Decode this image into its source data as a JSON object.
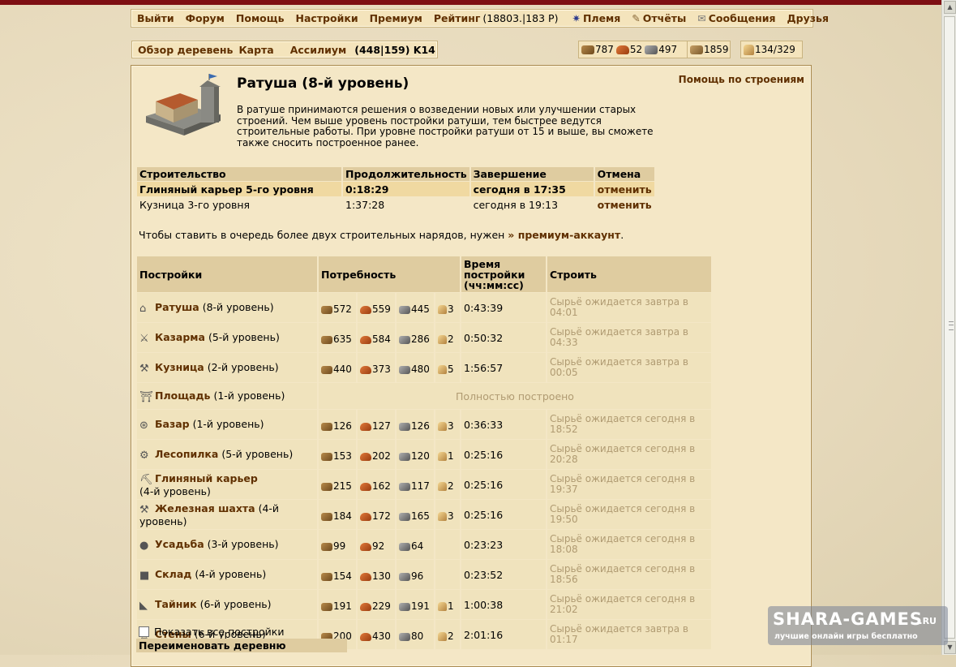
{
  "menu": {
    "logout": "Выйти",
    "forum": "Форум",
    "help": "Помощь",
    "settings": "Настройки",
    "premium": "Премиум",
    "ranking": "Рейтинг",
    "ranking_value": "(18803.|183 Р)",
    "tribe": "Племя",
    "reports": "Отчёты",
    "messages": "Сообщения",
    "friends": "Друзья"
  },
  "village": {
    "overview": "Обзор деревень",
    "map": "Карта",
    "name": "Ассилиум",
    "coords": "(448|159) K14"
  },
  "resources": {
    "wood": "787",
    "clay": "52",
    "iron": "497",
    "storage": "1859",
    "population": "134/329"
  },
  "building": {
    "title": "Ратуша (8-й уровень)",
    "help_link": "Помощь по строениям",
    "description": "В ратуше принимаются решения о возведении новых или улучшении старых строений. Чем выше уровень постройки ратуши, тем быстрее ведутся строительные работы. При уровне постройки ратуши от 15 и выше, вы сможете также сносить построенное ранее."
  },
  "queue": {
    "headers": [
      "Строительство",
      "Продолжительность",
      "Завершение",
      "Отмена"
    ],
    "rows": [
      {
        "name": "Глиняный карьер 5-го уровня",
        "duration": "0:18:29",
        "end": "сегодня в 17:35",
        "cancel": "отменить"
      },
      {
        "name": "Кузница 3-го уровня",
        "duration": "1:37:28",
        "end": "сегодня в 19:13",
        "cancel": "отменить"
      }
    ]
  },
  "premium_note": {
    "text": "Чтобы ставить в очередь более двух строительных нарядов, нужен",
    "link": "» премиум-аккаунт",
    "end": "."
  },
  "buildings": {
    "headers": {
      "name": "Постройки",
      "need": "Потребность",
      "time": "Время постройки (чч:мм:сс)",
      "build": "Строить"
    },
    "rows": [
      {
        "icon": "town-hall-icon",
        "name": "Ратуша",
        "level": "(8-й уровень)",
        "wood": "572",
        "clay": "559",
        "iron": "445",
        "pop": "3",
        "time": "0:43:39",
        "status": "Сырьё ожидается завтра в 04:01"
      },
      {
        "icon": "barracks-icon",
        "name": "Казарма",
        "level": "(5-й уровень)",
        "wood": "635",
        "clay": "584",
        "iron": "286",
        "pop": "2",
        "time": "0:50:32",
        "status": "Сырьё ожидается завтра в 04:33"
      },
      {
        "icon": "smithy-icon",
        "name": "Кузница",
        "level": "(2-й уровень)",
        "wood": "440",
        "clay": "373",
        "iron": "480",
        "pop": "5",
        "time": "1:56:57",
        "status": "Сырьё ожидается завтра в 00:05"
      },
      {
        "icon": "square-icon",
        "name": "Площадь",
        "level": "(1-й уровень)",
        "full": "Полностью построено"
      },
      {
        "icon": "market-icon",
        "name": "Базар",
        "level": "(1-й уровень)",
        "wood": "126",
        "clay": "127",
        "iron": "126",
        "pop": "3",
        "time": "0:36:33",
        "status": "Сырьё ожидается сегодня в 18:52"
      },
      {
        "icon": "sawmill-icon",
        "name": "Лесопилка",
        "level": "(5-й уровень)",
        "wood": "153",
        "clay": "202",
        "iron": "120",
        "pop": "1",
        "time": "0:25:16",
        "status": "Сырьё ожидается сегодня в 20:28"
      },
      {
        "icon": "clay-pit-icon",
        "name": "Глиняный карьер",
        "level": "(4-й уровень)",
        "wood": "215",
        "clay": "162",
        "iron": "117",
        "pop": "2",
        "time": "0:25:16",
        "status": "Сырьё ожидается сегодня в 19:37"
      },
      {
        "icon": "iron-mine-icon",
        "name": "Железная шахта",
        "level": "(4-й уровень)",
        "wood": "184",
        "clay": "172",
        "iron": "165",
        "pop": "3",
        "time": "0:25:16",
        "status": "Сырьё ожидается сегодня в 19:50"
      },
      {
        "icon": "farm-icon",
        "name": "Усадьба",
        "level": "(3-й уровень)",
        "wood": "99",
        "clay": "92",
        "iron": "64",
        "pop": "",
        "time": "0:23:23",
        "status": "Сырьё ожидается сегодня в 18:08"
      },
      {
        "icon": "warehouse-icon",
        "name": "Склад",
        "level": "(4-й уровень)",
        "wood": "154",
        "clay": "130",
        "iron": "96",
        "pop": "",
        "time": "0:23:52",
        "status": "Сырьё ожидается сегодня в 18:56"
      },
      {
        "icon": "hiding-place-icon",
        "name": "Тайник",
        "level": "(6-й уровень)",
        "wood": "191",
        "clay": "229",
        "iron": "191",
        "pop": "1",
        "time": "1:00:38",
        "status": "Сырьё ожидается сегодня в 21:02"
      },
      {
        "icon": "wall-icon",
        "name": "Стены",
        "level": "(6-й уровень)",
        "wood": "200",
        "clay": "430",
        "iron": "80",
        "pop": "2",
        "time": "2:01:16",
        "status": "Сырьё ожидается завтра в 01:17"
      }
    ]
  },
  "show_all": "Показать все постройки",
  "rename": "Переименовать деревню",
  "watermark": {
    "big": "SHARA-GAMES",
    "domain": ".RU",
    "small": "лучшие онлайн   игры бесплатно"
  }
}
